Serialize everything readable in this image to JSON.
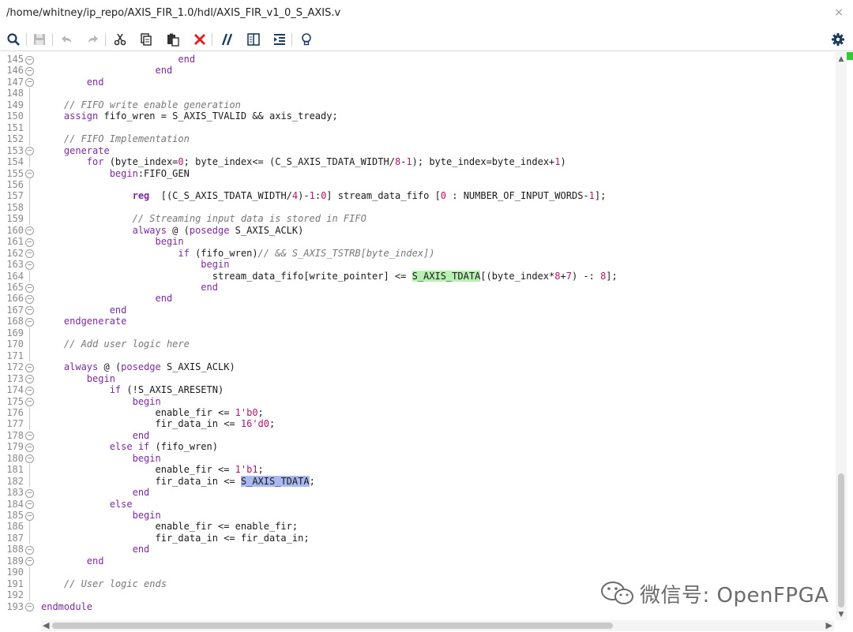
{
  "window": {
    "title": "/home/whitney/ip_repo/AXIS_FIR_1.0/hdl/AXIS_FIR_v1_0_S_AXIS.v",
    "close_glyph": "×"
  },
  "toolbar": {
    "icons": [
      "search-icon",
      "save-icon",
      "undo-icon",
      "redo-icon",
      "cut-icon",
      "copy-icon",
      "paste-icon",
      "delete-icon",
      "comment-icon",
      "toggle-block-icon",
      "indent-icon",
      "lightbulb-icon"
    ],
    "settings_icon": "gear-icon"
  },
  "editor": {
    "lines": [
      {
        "n": "145",
        "fold": true,
        "segs": [
          {
            "t": "                        "
          },
          {
            "t": "end",
            "c": "kw"
          }
        ]
      },
      {
        "n": "146",
        "fold": true,
        "segs": [
          {
            "t": "                    "
          },
          {
            "t": "end",
            "c": "kw"
          }
        ]
      },
      {
        "n": "147",
        "fold": true,
        "segs": [
          {
            "t": "        "
          },
          {
            "t": "end",
            "c": "kw"
          }
        ]
      },
      {
        "n": "148",
        "fold": false,
        "segs": []
      },
      {
        "n": "149",
        "fold": false,
        "segs": [
          {
            "t": "    "
          },
          {
            "t": "// FIFO write enable generation",
            "c": "cm"
          }
        ]
      },
      {
        "n": "150",
        "fold": false,
        "segs": [
          {
            "t": "    "
          },
          {
            "t": "assign",
            "c": "kw"
          },
          {
            "t": " fifo_wren = S_AXIS_TVALID && axis_tready;"
          }
        ]
      },
      {
        "n": "151",
        "fold": false,
        "segs": []
      },
      {
        "n": "152",
        "fold": false,
        "segs": [
          {
            "t": "    "
          },
          {
            "t": "// FIFO Implementation",
            "c": "cm"
          }
        ]
      },
      {
        "n": "153",
        "fold": true,
        "segs": [
          {
            "t": "    "
          },
          {
            "t": "generate",
            "c": "kw"
          }
        ]
      },
      {
        "n": "154",
        "fold": false,
        "segs": [
          {
            "t": "        "
          },
          {
            "t": "for",
            "c": "kw"
          },
          {
            "t": " (byte_index="
          },
          {
            "t": "0",
            "c": "nm"
          },
          {
            "t": "; byte_index<= (C_S_AXIS_TDATA_WIDTH/"
          },
          {
            "t": "8",
            "c": "nm"
          },
          {
            "t": "-"
          },
          {
            "t": "1",
            "c": "nm"
          },
          {
            "t": "); byte_index=byte_index+"
          },
          {
            "t": "1",
            "c": "nm"
          },
          {
            "t": ")"
          }
        ]
      },
      {
        "n": "155",
        "fold": true,
        "segs": [
          {
            "t": "            "
          },
          {
            "t": "begin",
            "c": "kw"
          },
          {
            "t": ":FIFO_GEN"
          }
        ]
      },
      {
        "n": "156",
        "fold": false,
        "segs": []
      },
      {
        "n": "157",
        "fold": false,
        "segs": [
          {
            "t": "                "
          },
          {
            "t": "reg",
            "c": "kwb"
          },
          {
            "t": "  [(C_S_AXIS_TDATA_WIDTH/"
          },
          {
            "t": "4",
            "c": "nm"
          },
          {
            "t": ")-"
          },
          {
            "t": "1",
            "c": "nm"
          },
          {
            "t": ":"
          },
          {
            "t": "0",
            "c": "nm"
          },
          {
            "t": "] stream_data_fifo ["
          },
          {
            "t": "0",
            "c": "nm"
          },
          {
            "t": " : NUMBER_OF_INPUT_WORDS-"
          },
          {
            "t": "1",
            "c": "nm"
          },
          {
            "t": "];"
          }
        ]
      },
      {
        "n": "158",
        "fold": false,
        "segs": []
      },
      {
        "n": "159",
        "fold": false,
        "segs": [
          {
            "t": "                "
          },
          {
            "t": "// Streaming input data is stored in FIFO",
            "c": "cm"
          }
        ]
      },
      {
        "n": "160",
        "fold": true,
        "segs": [
          {
            "t": "                "
          },
          {
            "t": "always",
            "c": "kw"
          },
          {
            "t": " @ ("
          },
          {
            "t": "posedge",
            "c": "kw"
          },
          {
            "t": " S_AXIS_ACLK)"
          }
        ]
      },
      {
        "n": "161",
        "fold": true,
        "segs": [
          {
            "t": "                    "
          },
          {
            "t": "begin",
            "c": "kw"
          }
        ]
      },
      {
        "n": "162",
        "fold": true,
        "segs": [
          {
            "t": "                        "
          },
          {
            "t": "if",
            "c": "kw"
          },
          {
            "t": " (fifo_wren)"
          },
          {
            "t": "// && S_AXIS_TSTRB[byte_index])",
            "c": "cm"
          }
        ]
      },
      {
        "n": "163",
        "fold": true,
        "segs": [
          {
            "t": "                            "
          },
          {
            "t": "begin",
            "c": "kw"
          }
        ]
      },
      {
        "n": "164",
        "fold": false,
        "segs": [
          {
            "t": "                              stream_data_fifo[write_pointer] <= "
          },
          {
            "t": "S_AXIS_TDATA",
            "c": "hl-green"
          },
          {
            "t": "[(byte_index*"
          },
          {
            "t": "8",
            "c": "nm"
          },
          {
            "t": "+"
          },
          {
            "t": "7",
            "c": "nm"
          },
          {
            "t": ") -: "
          },
          {
            "t": "8",
            "c": "nm"
          },
          {
            "t": "];"
          }
        ]
      },
      {
        "n": "165",
        "fold": true,
        "segs": [
          {
            "t": "                            "
          },
          {
            "t": "end",
            "c": "kw"
          }
        ]
      },
      {
        "n": "166",
        "fold": true,
        "segs": [
          {
            "t": "                    "
          },
          {
            "t": "end",
            "c": "kw"
          }
        ]
      },
      {
        "n": "167",
        "fold": true,
        "segs": [
          {
            "t": "            "
          },
          {
            "t": "end",
            "c": "kw"
          }
        ]
      },
      {
        "n": "168",
        "fold": true,
        "segs": [
          {
            "t": "    "
          },
          {
            "t": "endgenerate",
            "c": "kw"
          }
        ]
      },
      {
        "n": "169",
        "fold": false,
        "segs": []
      },
      {
        "n": "170",
        "fold": false,
        "segs": [
          {
            "t": "    "
          },
          {
            "t": "// Add user logic here",
            "c": "cm"
          }
        ]
      },
      {
        "n": "171",
        "fold": false,
        "segs": []
      },
      {
        "n": "172",
        "fold": true,
        "segs": [
          {
            "t": "    "
          },
          {
            "t": "always",
            "c": "kw"
          },
          {
            "t": " @ ("
          },
          {
            "t": "posedge",
            "c": "kw"
          },
          {
            "t": " S_AXIS_ACLK)"
          }
        ]
      },
      {
        "n": "173",
        "fold": true,
        "segs": [
          {
            "t": "        "
          },
          {
            "t": "begin",
            "c": "kw"
          }
        ]
      },
      {
        "n": "174",
        "fold": true,
        "segs": [
          {
            "t": "            "
          },
          {
            "t": "if",
            "c": "kw"
          },
          {
            "t": " (!S_AXIS_ARESETN)"
          }
        ]
      },
      {
        "n": "175",
        "fold": true,
        "segs": [
          {
            "t": "                "
          },
          {
            "t": "begin",
            "c": "kw"
          }
        ]
      },
      {
        "n": "176",
        "fold": false,
        "segs": [
          {
            "t": "                    enable_fir <= "
          },
          {
            "t": "1'b0",
            "c": "nm"
          },
          {
            "t": ";"
          }
        ]
      },
      {
        "n": "177",
        "fold": false,
        "segs": [
          {
            "t": "                    fir_data_in <= "
          },
          {
            "t": "16'd0",
            "c": "nm"
          },
          {
            "t": ";"
          }
        ]
      },
      {
        "n": "178",
        "fold": true,
        "segs": [
          {
            "t": "                "
          },
          {
            "t": "end",
            "c": "kw"
          }
        ]
      },
      {
        "n": "179",
        "fold": true,
        "segs": [
          {
            "t": "            "
          },
          {
            "t": "else if",
            "c": "kw"
          },
          {
            "t": " (fifo_wren)"
          }
        ]
      },
      {
        "n": "180",
        "fold": true,
        "segs": [
          {
            "t": "                "
          },
          {
            "t": "begin",
            "c": "kw"
          }
        ]
      },
      {
        "n": "181",
        "fold": false,
        "segs": [
          {
            "t": "                    enable_fir <= "
          },
          {
            "t": "1'b1",
            "c": "nm"
          },
          {
            "t": ";"
          }
        ]
      },
      {
        "n": "182",
        "fold": false,
        "segs": [
          {
            "t": "                    fir_data_in <= "
          },
          {
            "t": "S_AXIS_TDATA",
            "c": "hl-blue"
          },
          {
            "t": ";"
          }
        ]
      },
      {
        "n": "183",
        "fold": true,
        "segs": [
          {
            "t": "                "
          },
          {
            "t": "end",
            "c": "kw"
          }
        ]
      },
      {
        "n": "184",
        "fold": true,
        "segs": [
          {
            "t": "            "
          },
          {
            "t": "else",
            "c": "kw"
          }
        ]
      },
      {
        "n": "185",
        "fold": true,
        "segs": [
          {
            "t": "                "
          },
          {
            "t": "begin",
            "c": "kw"
          }
        ]
      },
      {
        "n": "186",
        "fold": false,
        "segs": [
          {
            "t": "                    enable_fir <= enable_fir;"
          }
        ]
      },
      {
        "n": "187",
        "fold": false,
        "segs": [
          {
            "t": "                    fir_data_in <= fir_data_in;"
          }
        ]
      },
      {
        "n": "188",
        "fold": true,
        "segs": [
          {
            "t": "                "
          },
          {
            "t": "end",
            "c": "kw"
          }
        ]
      },
      {
        "n": "189",
        "fold": true,
        "segs": [
          {
            "t": "        "
          },
          {
            "t": "end",
            "c": "kw"
          }
        ]
      },
      {
        "n": "190",
        "fold": false,
        "segs": []
      },
      {
        "n": "191",
        "fold": false,
        "segs": [
          {
            "t": "    "
          },
          {
            "t": "// User logic ends",
            "c": "cm"
          }
        ]
      },
      {
        "n": "192",
        "fold": false,
        "segs": []
      },
      {
        "n": "193",
        "fold": true,
        "segs": [
          {
            "t": "endmodule",
            "c": "kw"
          }
        ]
      }
    ]
  },
  "colors": {
    "keyword": "#7a2aa0",
    "comment": "#777777",
    "number": "#b0156a",
    "highlight_green": "#b8f0b4",
    "highlight_blue": "#a9b8ee",
    "delete_red": "#e02020",
    "marker_green": "#37c837"
  },
  "watermark": {
    "text": "微信号: OpenFPGA",
    "icon": "wechat-icon"
  },
  "scroll": {
    "vertical_position": 0.84,
    "horizontal_position": 0.0
  }
}
